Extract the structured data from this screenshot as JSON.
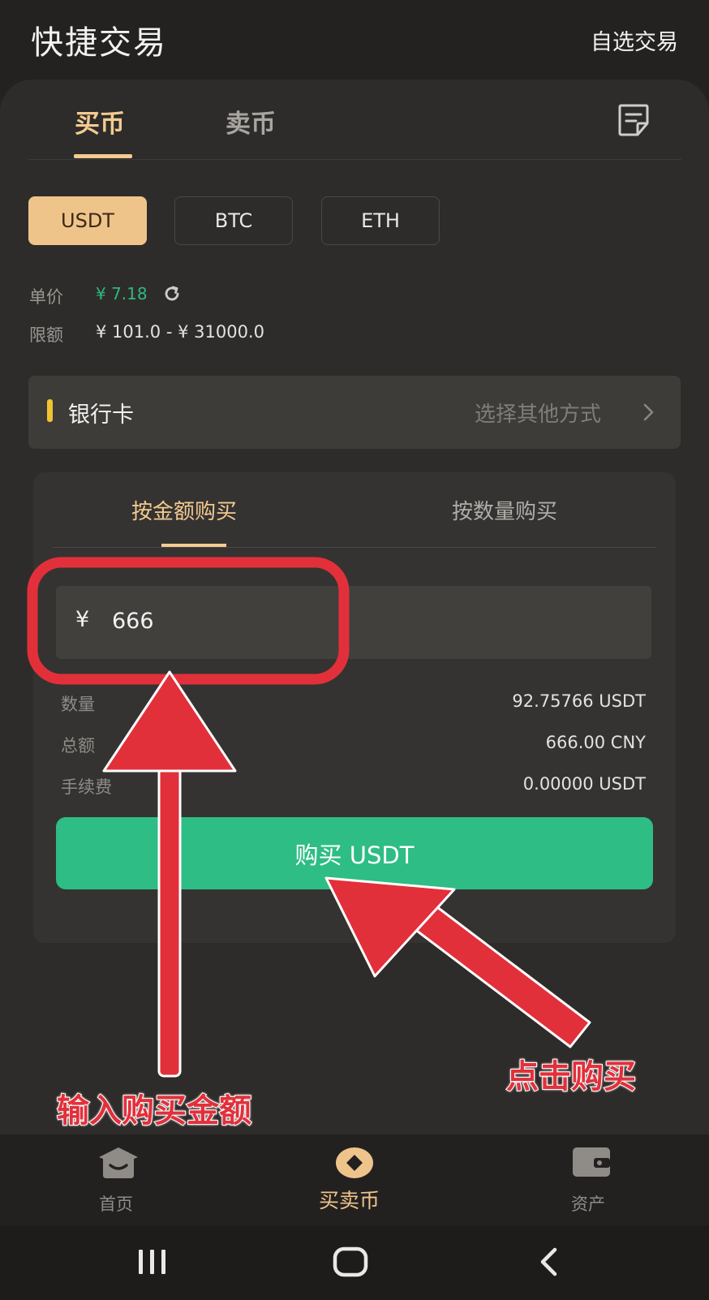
{
  "header": {
    "title": "快捷交易",
    "link": "自选交易"
  },
  "tabs": {
    "buy": "买币",
    "sell": "卖币"
  },
  "coins": [
    "USDT",
    "BTC",
    "ETH"
  ],
  "info": {
    "price_label": "单价",
    "price_value": "¥ 7.18",
    "limit_label": "限额",
    "limit_value": "¥ 101.0 - ¥ 31000.0"
  },
  "payment": {
    "label": "银行卡",
    "other": "选择其他方式"
  },
  "form": {
    "tab_amount": "按金额购买",
    "tab_quantity": "按数量购买",
    "currency_symbol": "¥",
    "amount_value": "666",
    "rows": [
      {
        "label": "数量",
        "value": "92.75766 USDT"
      },
      {
        "label": "总额",
        "value": "666.00 CNY"
      },
      {
        "label": "手续费",
        "value": "0.00000 USDT"
      }
    ],
    "buy_button": "购买 USDT"
  },
  "bottom_nav": [
    {
      "label": "首页",
      "icon": "home-icon"
    },
    {
      "label": "买卖币",
      "icon": "trade-icon"
    },
    {
      "label": "资产",
      "icon": "wallet-icon"
    }
  ],
  "annotations": {
    "enter_amount": "输入购买金额",
    "click_buy": "点击购买"
  },
  "colors": {
    "accent": "#f3cb91",
    "buy_green": "#2ebd84",
    "price_green": "#2eb87e",
    "annotation_red": "#e2303b"
  }
}
